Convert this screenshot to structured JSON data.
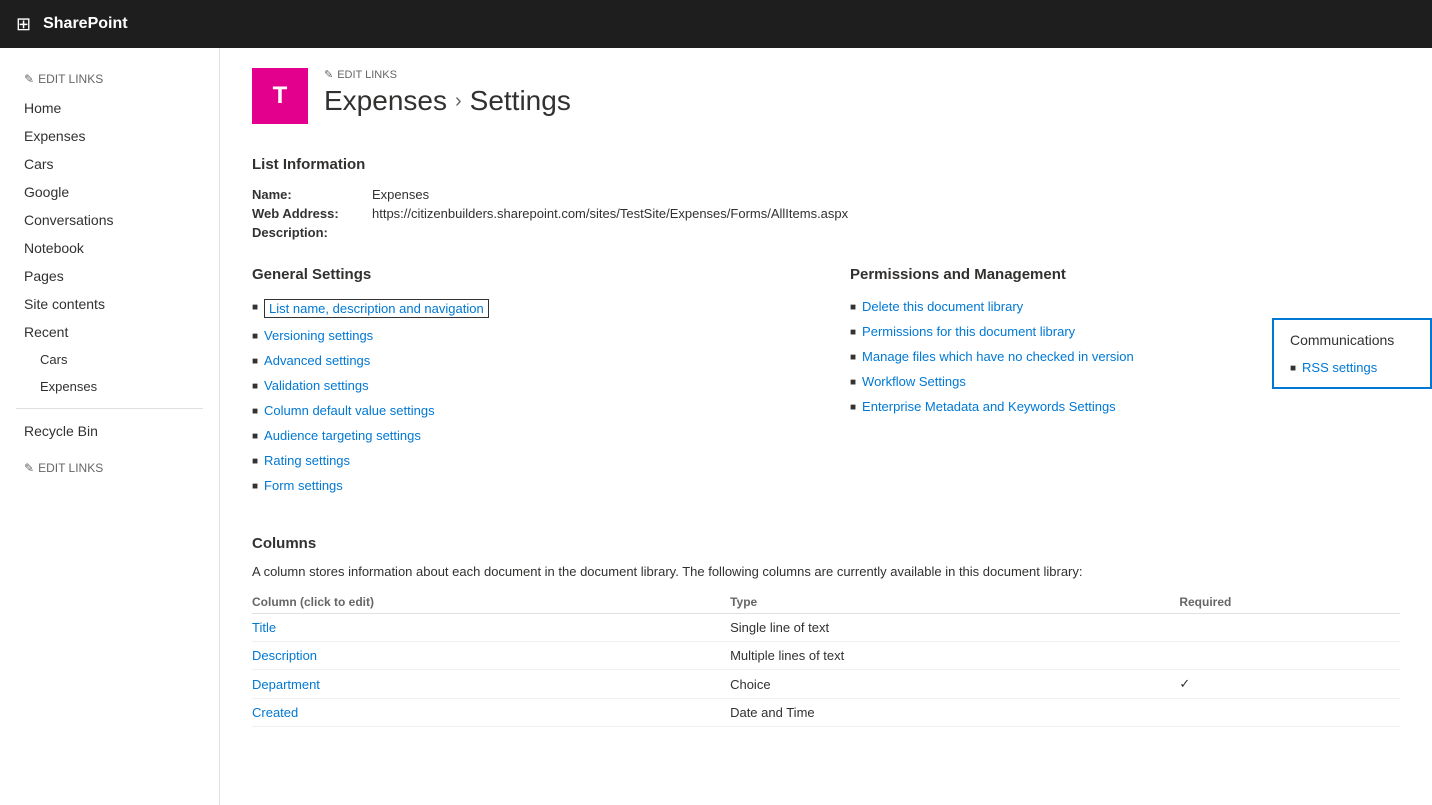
{
  "topbar": {
    "waffle_icon": "⊞",
    "title": "SharePoint"
  },
  "site_icon": {
    "letter": "T"
  },
  "header": {
    "edit_links_label": "EDIT LINKS",
    "breadcrumb_part1": "Expenses",
    "breadcrumb_separator": "›",
    "breadcrumb_part2": "Settings"
  },
  "sidebar": {
    "edit_links_top": "EDIT LINKS",
    "items": [
      {
        "label": "Home",
        "level": "top"
      },
      {
        "label": "Expenses",
        "level": "top"
      },
      {
        "label": "Cars",
        "level": "top"
      },
      {
        "label": "Google",
        "level": "top"
      },
      {
        "label": "Conversations",
        "level": "top"
      },
      {
        "label": "Notebook",
        "level": "top"
      },
      {
        "label": "Pages",
        "level": "top"
      },
      {
        "label": "Site contents",
        "level": "top"
      },
      {
        "label": "Recent",
        "level": "top"
      },
      {
        "label": "Cars",
        "level": "sub"
      },
      {
        "label": "Expenses",
        "level": "sub"
      },
      {
        "label": "Recycle Bin",
        "level": "top"
      }
    ],
    "edit_links_bottom": "EDIT LINKS"
  },
  "list_info": {
    "section_title": "List Information",
    "name_label": "Name:",
    "name_value": "Expenses",
    "web_address_label": "Web Address:",
    "web_address_value": "https://citizenbuilders.sharepoint.com/sites/TestSite/Expenses/Forms/AllItems.aspx",
    "description_label": "Description:"
  },
  "general_settings": {
    "title": "General Settings",
    "links": [
      {
        "label": "List name, description and navigation",
        "highlighted": true
      },
      {
        "label": "Versioning settings",
        "highlighted": false
      },
      {
        "label": "Advanced settings",
        "highlighted": false
      },
      {
        "label": "Validation settings",
        "highlighted": false
      },
      {
        "label": "Column default value settings",
        "highlighted": false
      },
      {
        "label": "Audience targeting settings",
        "highlighted": false
      },
      {
        "label": "Rating settings",
        "highlighted": false
      },
      {
        "label": "Form settings",
        "highlighted": false
      }
    ]
  },
  "permissions_management": {
    "title": "Permissions and Management",
    "links": [
      {
        "label": "Delete this document library"
      },
      {
        "label": "Permissions for this document library"
      },
      {
        "label": "Manage files which have no checked in version"
      },
      {
        "label": "Workflow Settings"
      },
      {
        "label": "Enterprise Metadata and Keywords Settings"
      }
    ]
  },
  "communications": {
    "title": "Communications",
    "links": [
      {
        "label": "RSS settings"
      }
    ]
  },
  "columns": {
    "section_title": "Columns",
    "description": "A column stores information about each document in the document library. The following columns are currently available in this document library:",
    "headers": {
      "column": "Column (click to edit)",
      "type": "Type",
      "required": "Required"
    },
    "rows": [
      {
        "column": "Title",
        "type": "Single line of text",
        "required": ""
      },
      {
        "column": "Description",
        "type": "Multiple lines of text",
        "required": ""
      },
      {
        "column": "Department",
        "type": "Choice",
        "required": "✓"
      },
      {
        "column": "Created",
        "type": "Date and Time",
        "required": ""
      }
    ]
  }
}
